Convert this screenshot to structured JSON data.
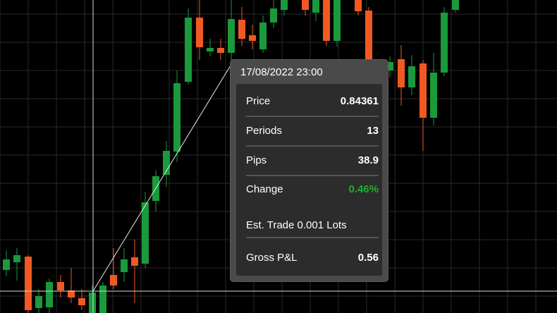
{
  "tooltip": {
    "datetime": "17/08/2022 23:00",
    "rows": [
      {
        "label": "Price",
        "value": "0.84361"
      },
      {
        "label": "Periods",
        "value": "13"
      },
      {
        "label": "Pips",
        "value": "38.9"
      },
      {
        "label": "Change",
        "value": "0.46%"
      }
    ],
    "est_trade": "Est. Trade 0.001 Lots",
    "gross": {
      "label": "Gross P&L",
      "value": "0.56"
    }
  },
  "colors": {
    "background": "#000000",
    "grid": "#2a2a2a",
    "up_candle": "#1a9a3c",
    "down_candle": "#f05a22",
    "crosshair": "#d8d8d8",
    "change_positive": "#1db12c"
  }
}
